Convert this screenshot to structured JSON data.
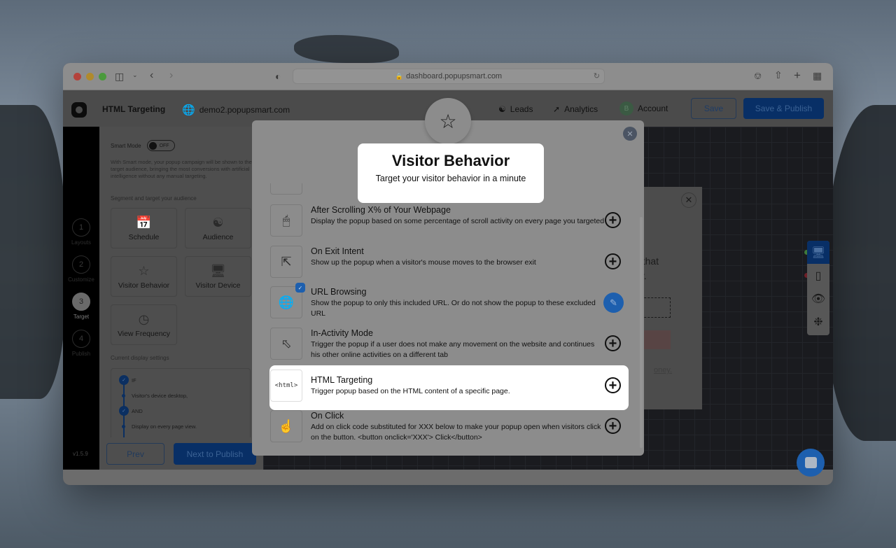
{
  "browser": {
    "url": "dashboard.popupsmart.com",
    "icons": [
      "sidebar-icon",
      "chevron-down-icon",
      "back-icon",
      "forward-icon",
      "shield-icon",
      "lock-icon",
      "reload-icon",
      "download-icon",
      "share-icon",
      "new-tab-icon",
      "tab-overview-icon"
    ]
  },
  "appbar": {
    "title": "HTML Targeting",
    "site": "demo2.popupsmart.com",
    "nav": [
      {
        "label": "Leads",
        "icon": "leads-icon"
      },
      {
        "label": "Analytics",
        "icon": "analytics-icon"
      },
      {
        "label": "Account",
        "icon": "avatar",
        "avatar_letter": "B"
      }
    ],
    "save_label": "Save",
    "publish_label": "Save & Publish"
  },
  "steps": [
    {
      "number": "1",
      "label": "Layouts",
      "active": false
    },
    {
      "number": "2",
      "label": "Customize",
      "active": false
    },
    {
      "number": "3",
      "label": "Target",
      "active": true
    },
    {
      "number": "4",
      "label": "Publish",
      "active": false
    }
  ],
  "version": "v1.5.9",
  "panel": {
    "smart_mode_label": "Smart Mode",
    "smart_mode_state": "OFF",
    "smart_mode_desc": "With Smart mode, your popup campaign will be shown to the target audience, bringing the most conversions with artificial intelligence without any manual targeting.",
    "segment_label": "Segment and target your audience",
    "cards": [
      {
        "label": "Schedule",
        "icon": "calendar-clock-icon"
      },
      {
        "label": "Audience",
        "icon": "audience-icon"
      },
      {
        "label": "Visitor Behavior",
        "icon": "star-hand-icon"
      },
      {
        "label": "Visitor Device",
        "icon": "devices-icon"
      },
      {
        "label": "View Frequency",
        "icon": "clock-refresh-icon"
      }
    ],
    "current_settings_label": "Current display settings",
    "timeline": [
      {
        "type": "check",
        "text": "IF"
      },
      {
        "type": "dot",
        "text": "Visitor's device desktop,"
      },
      {
        "type": "check",
        "text": "AND"
      },
      {
        "type": "dot",
        "text": "Display on every page view."
      }
    ],
    "prev_label": "Prev",
    "next_label": "Next to Publish"
  },
  "preview": {
    "text_line1": "n that",
    "text_line2": "ay.",
    "link_text": "oney."
  },
  "modal": {
    "title": "Visitor Behavior",
    "subtitle": "Target your visitor behavior in a minute",
    "options": [
      {
        "title": "After Scrolling X% of Your Webpage",
        "desc": "Display the popup based on some percentage of scroll activity on every page you targeted",
        "icon": "scroll-mouse-icon",
        "state": "add"
      },
      {
        "title": "On Exit Intent",
        "desc": "Show up the popup when a visitor's mouse moves to the browser exit",
        "icon": "exit-intent-icon",
        "state": "add"
      },
      {
        "title": "URL Browsing",
        "desc": "Show the popup to only this included URL. Or do not show the popup to these excluded URL",
        "icon": "globe-link-icon",
        "state": "edit",
        "selected": true
      },
      {
        "title": "In-Activity Mode",
        "desc": "Trigger the popup if a user does not make any movement on the website and continues his other online activities on a different tab",
        "icon": "cursor-window-icon",
        "state": "add"
      },
      {
        "title": "HTML Targeting",
        "desc": "Trigger popup based on the HTML content of a specific page.",
        "icon": "html-monitor-icon",
        "state": "add",
        "highlighted": true
      },
      {
        "title": "On Click",
        "desc": "Add on click code substituted for XXX below to make your popup open when visitors click on the button. <button onclick='XXX'> Click</button>",
        "icon": "click-hand-icon",
        "state": "add"
      }
    ]
  }
}
